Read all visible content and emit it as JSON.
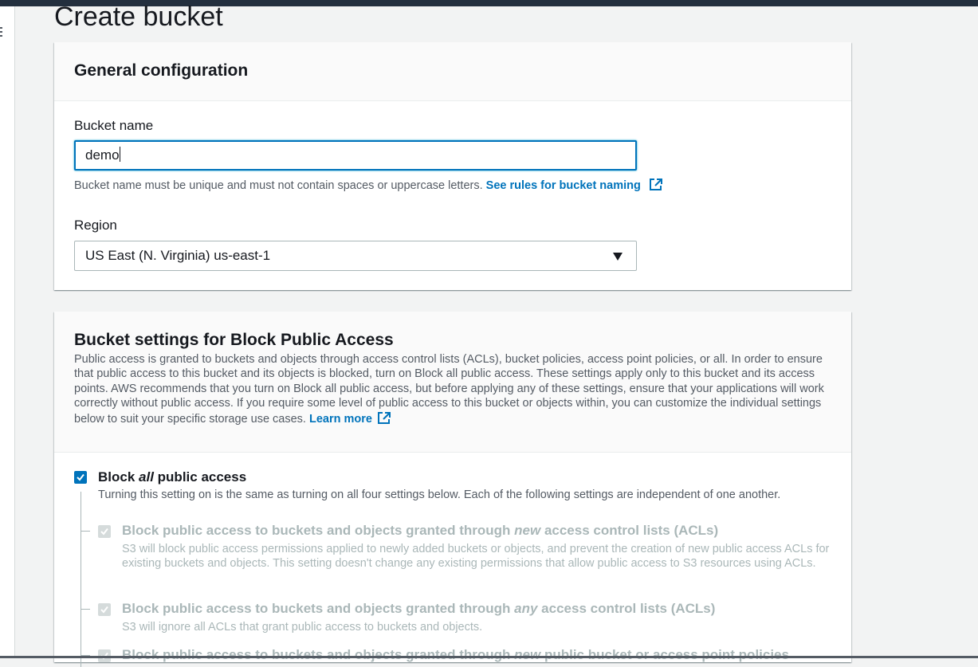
{
  "page": {
    "title": "Create bucket"
  },
  "general": {
    "heading": "General configuration",
    "bucket_name_label": "Bucket name",
    "bucket_name_value": "demo",
    "help_text": "Bucket name must be unique and must not contain spaces or uppercase letters.",
    "help_link": "See rules for bucket naming",
    "region_label": "Region",
    "region_value": "US East (N. Virginia) us-east-1"
  },
  "block_public_access": {
    "heading": "Bucket settings for Block Public Access",
    "description": "Public access is granted to buckets and objects through access control lists (ACLs), bucket policies, access point policies, or all. In order to ensure that public access to this bucket and its objects is blocked, turn on Block all public access. These settings apply only to this bucket and its access points. AWS recommends that you turn on Block all public access, but before applying any of these settings, ensure that your applications will work correctly without public access. If you require some level of public access to this bucket or objects within, you can customize the individual settings below to suit your specific storage use cases.",
    "learn_more": "Learn more",
    "block_all": {
      "label_prefix": "Block ",
      "label_emphasis": "all",
      "label_suffix": " public access",
      "checked": true,
      "description": "Turning this setting on is the same as turning on all four settings below. Each of the following settings are independent of one another."
    },
    "options": [
      {
        "label_prefix": "Block public access to buckets and objects granted through ",
        "label_emphasis": "new",
        "label_suffix": " access control lists (ACLs)",
        "checked": true,
        "disabled": true,
        "description": "S3 will block public access permissions applied to newly added buckets or objects, and prevent the creation of new public access ACLs for existing buckets and objects. This setting doesn't change any existing permissions that allow public access to S3 resources using ACLs."
      },
      {
        "label_prefix": "Block public access to buckets and objects granted through ",
        "label_emphasis": "any",
        "label_suffix": " access control lists (ACLs)",
        "checked": true,
        "disabled": true,
        "description": "S3 will ignore all ACLs that grant public access to buckets and objects."
      },
      {
        "label_prefix": "Block public access to buckets and objects granted through ",
        "label_emphasis": "new",
        "label_suffix": " public bucket or access point policies",
        "checked": true,
        "disabled": true
      }
    ]
  },
  "icons": {
    "menu": "hamburger-menu-icon",
    "external": "external-link-icon",
    "dropdown": "caret-down-icon",
    "check": "checkmark-icon"
  },
  "colors": {
    "accent": "#0073bb",
    "topbar": "#232f3e",
    "background": "#f2f3f3",
    "disabled": "#aab7b8"
  }
}
